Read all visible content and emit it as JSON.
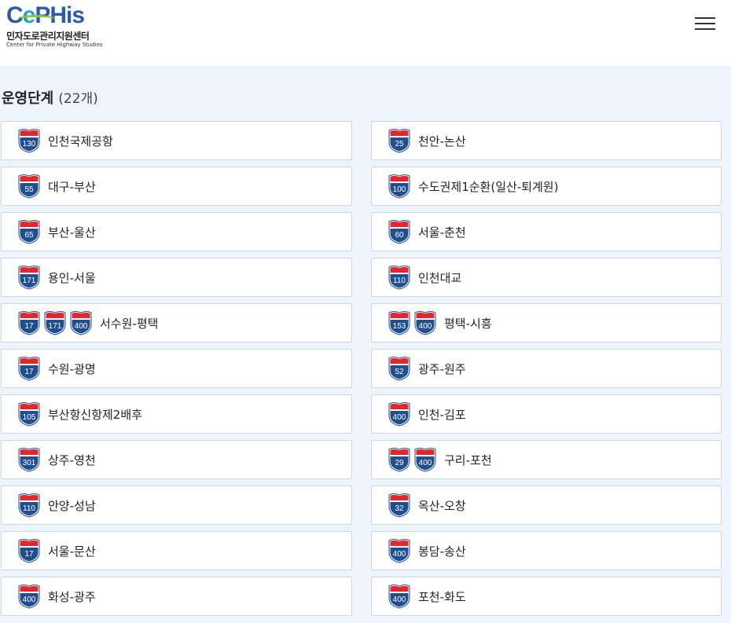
{
  "header": {
    "logo": {
      "word": {
        "c": "C",
        "e": "e",
        "p": "P",
        "his": "His"
      },
      "ko_name": "민자도로관리지원센터",
      "en_name": "Center for Private Highway Studies"
    }
  },
  "section": {
    "title": "운영단계",
    "count": "(22개)"
  },
  "colors": {
    "shield_top": "#e2262b",
    "shield_bottom": "#1f4e91",
    "card_border": "#cfd6de",
    "page_bg": "#eef4fb"
  },
  "routes": [
    {
      "name": "인천국제공항",
      "shields": [
        "130"
      ]
    },
    {
      "name": "천안-논산",
      "shields": [
        "25"
      ]
    },
    {
      "name": "대구-부산",
      "shields": [
        "55"
      ]
    },
    {
      "name": "수도권제1순환(일산-퇴계원)",
      "shields": [
        "100"
      ]
    },
    {
      "name": "부산-울산",
      "shields": [
        "65"
      ]
    },
    {
      "name": "서울-춘천",
      "shields": [
        "60"
      ]
    },
    {
      "name": "용인-서울",
      "shields": [
        "171"
      ]
    },
    {
      "name": "인천대교",
      "shields": [
        "110"
      ]
    },
    {
      "name": "서수원-평택",
      "shields": [
        "17",
        "171",
        "400"
      ]
    },
    {
      "name": "평택-시흥",
      "shields": [
        "153",
        "400"
      ]
    },
    {
      "name": "수원-광명",
      "shields": [
        "17"
      ]
    },
    {
      "name": "광주-원주",
      "shields": [
        "52"
      ]
    },
    {
      "name": "부산항신항제2배후",
      "shields": [
        "105"
      ]
    },
    {
      "name": "인천-김포",
      "shields": [
        "400"
      ]
    },
    {
      "name": "상주-영천",
      "shields": [
        "301"
      ]
    },
    {
      "name": "구리-포천",
      "shields": [
        "29",
        "400"
      ]
    },
    {
      "name": "안양-성남",
      "shields": [
        "110"
      ]
    },
    {
      "name": "옥산-오창",
      "shields": [
        "32"
      ]
    },
    {
      "name": "서울-문산",
      "shields": [
        "17"
      ]
    },
    {
      "name": "봉담-송산",
      "shields": [
        "400"
      ]
    },
    {
      "name": "화성-광주",
      "shields": [
        "400"
      ]
    },
    {
      "name": "포천-화도",
      "shields": [
        "400"
      ]
    }
  ]
}
